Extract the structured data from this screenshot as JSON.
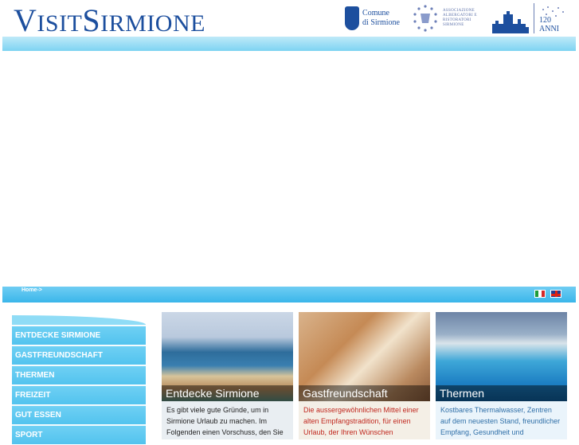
{
  "header": {
    "logo_big_1": "V",
    "logo_small_1": "ISIT",
    "logo_big_2": "S",
    "logo_small_2": "IRMIONE",
    "partner_comune_line1": "Comune",
    "partner_comune_line2": "di Sirmione",
    "partner_assoc_text": "ASSOCIAZIONE ALBERGATORI E RISTORATORI SIRMIONE",
    "partner_terme_label": "120 ANNI"
  },
  "breadcrumb": {
    "home": "Home->"
  },
  "languages": [
    "italiano",
    "english"
  ],
  "sidebar": {
    "items": [
      {
        "label": "ENTDECKE SIRMIONE"
      },
      {
        "label": "GASTFREUNDSCHAFT"
      },
      {
        "label": "THERMEN"
      },
      {
        "label": "FREIZEIT"
      },
      {
        "label": "GUT ESSEN"
      },
      {
        "label": "SPORT"
      }
    ]
  },
  "cards": [
    {
      "title": "Entdecke Sirmione",
      "text": "Es gibt viele gute Gründe, um in Sirmione Urlaub zu machen. Im Folgenden einen Vorschuss, den Sie"
    },
    {
      "title": "Gastfreundschaft",
      "text": "Die aussergewöhnlichen Mittel einer alten Empfangstradition, für einen Urlaub, der Ihren Wünschen entspricht"
    },
    {
      "title": "Thermen",
      "text": "Kostbares Thermalwasser, Zentren auf dem neuesten Stand, freundlicher Empfang, Gesundheit und Wohlbefinde"
    }
  ],
  "colors": {
    "brand_blue": "#1d4f9e",
    "menu_cyan": "#52c3ee",
    "gastfreund_red": "#c0281f",
    "thermen_blue": "#2f6fa8"
  }
}
